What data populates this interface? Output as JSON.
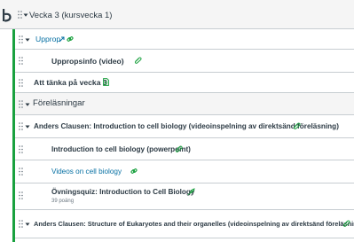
{
  "module": {
    "title": "Vecka 3 (kursvecka 1)"
  },
  "rows": [
    {
      "label": "Upprop"
    },
    {
      "label": "Uppropsinfo (video)"
    },
    {
      "label": "Att tänka på vecka 3"
    },
    {
      "label": "Föreläsningar"
    },
    {
      "label": "Anders Clausen: Introduction to cell biology (videoinspelning av direktsänd föreläsning)"
    },
    {
      "label": "Introduction to cell biology (powerpoint)"
    },
    {
      "label": "Videos on cell biology"
    },
    {
      "label": "Övningsquiz: Introduction to Cell Biology",
      "meta": "39 poäng"
    },
    {
      "label": "Anders Clausen: Structure of Eukaryotes and their organelles (videoinspelning av direktsänd föreläsning)"
    }
  ],
  "colors": {
    "accent_green": "#1aa13f",
    "link_blue": "#0770a3",
    "quiz_green": "#1aa13f"
  },
  "icons": [
    "drag-handle-icon",
    "chevron-down-icon",
    "link-icon",
    "external-link-icon",
    "paperclip-icon",
    "document-icon",
    "rocket-icon"
  ]
}
